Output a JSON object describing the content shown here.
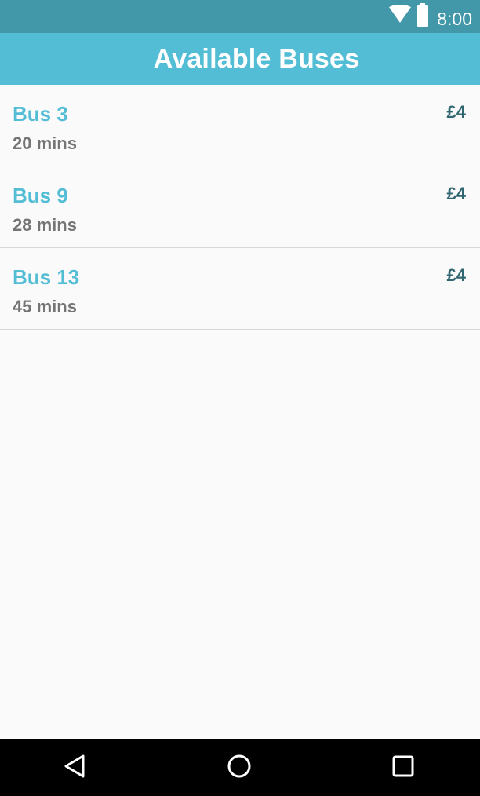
{
  "status_bar": {
    "time": "8:00",
    "icons": [
      "wifi-icon",
      "battery-icon"
    ]
  },
  "app_bar": {
    "title": "Available Buses"
  },
  "buses": [
    {
      "name": "Bus 3",
      "duration": "20 mins",
      "price": "£4"
    },
    {
      "name": "Bus 9",
      "duration": "28 mins",
      "price": "£4"
    },
    {
      "name": "Bus 13",
      "duration": "45 mins",
      "price": "£4"
    }
  ],
  "nav_bar": {
    "buttons": [
      "back-icon",
      "home-icon",
      "recents-icon"
    ]
  },
  "colors": {
    "status_bar": "#4297a8",
    "app_bar": "#52bdd5",
    "accent": "#52bdd5",
    "price": "#2f6670",
    "secondary_text": "#757575",
    "background": "#fafafa",
    "nav_bar": "#000000"
  }
}
